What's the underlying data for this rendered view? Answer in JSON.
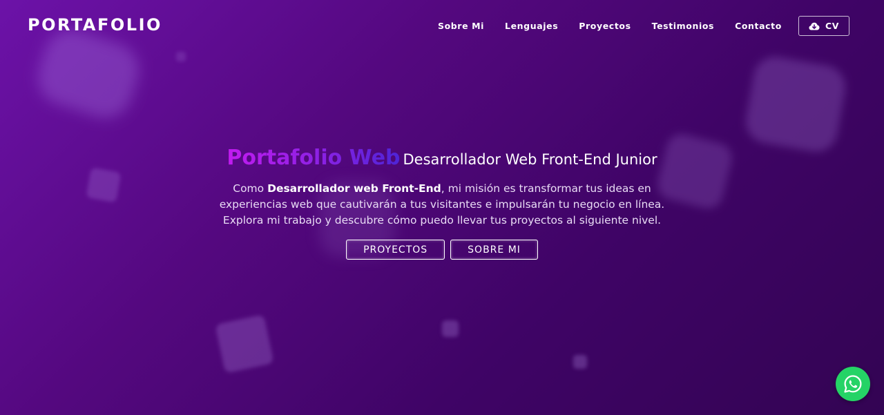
{
  "header": {
    "brand": "PORTAFOLIO",
    "nav": [
      {
        "label": "Sobre Mi"
      },
      {
        "label": "Lenguajes"
      },
      {
        "label": "Proyectos"
      },
      {
        "label": "Testimonios"
      },
      {
        "label": "Contacto"
      }
    ],
    "cv_button": {
      "label": "CV",
      "icon": "cloud-download-icon"
    }
  },
  "hero": {
    "highlight": "Portafolio Web",
    "role": "Desarrollador Web Front-End Junior",
    "desc_prefix": "Como ",
    "desc_bold": "Desarrollador web Front-End",
    "desc_suffix": ", mi misión es transformar tus ideas en experiencias web que cautivarán a tus visitantes e impulsarán tu negocio en línea. Explora mi trabajo y descubre cómo puedo llevar tus proyectos al siguiente nivel.",
    "buttons": [
      {
        "label": "PROYECTOS"
      },
      {
        "label": "SOBRE MI"
      }
    ]
  },
  "floating": {
    "whatsapp_icon": "whatsapp-icon"
  },
  "colors": {
    "background_start": "#6c12a8",
    "background_end": "#330453",
    "highlight_start": "#c21bf0",
    "highlight_end": "#4d24d6",
    "whatsapp": "#25d366"
  }
}
